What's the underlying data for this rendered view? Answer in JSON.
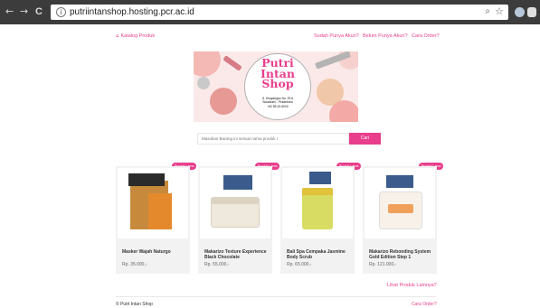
{
  "browser": {
    "back_icon": "←",
    "forward_icon": "→",
    "reload_icon": "C",
    "info_icon": "i",
    "url": "putriintanshop.hosting.pcr.ac.id",
    "zoom_icon": "⌕",
    "star_icon": "☆"
  },
  "nav": {
    "home_icon": "⌂",
    "catalog": "Katalog Produk",
    "has_account": "Sudah Punya Akun?",
    "no_account": "Belum Punya Akun?",
    "track_order": "Cara Order?"
  },
  "banner": {
    "brand_line1": "Putri",
    "brand_line2": "Intan",
    "brand_line3": "Shop",
    "address_line1": "Jl. Khayangan No. 29 A",
    "address_line2": "Sukabumi - Pekanbaru",
    "address_line3": "+62 85-22-6000"
  },
  "search": {
    "placeholder": "Masukan Barang ini sesuai nama produk !",
    "button": "Cari"
  },
  "badge_label": "Produk Lama",
  "products": [
    {
      "name": "Masker Wajah Naturgo",
      "price": "Rp. 35.000,-"
    },
    {
      "name": "Makarizo Texture Experience Black Chocolate",
      "price": "Rp. 55.000,-"
    },
    {
      "name": "Bali Spa Cempaka Jasmine Body Scrub",
      "price": "Rp. 65.000,-"
    },
    {
      "name": "Makarizo Rebonding System Gold Edition Step 1",
      "price": "Rp. 121.000,-"
    }
  ],
  "more_link": "Lihat Produk Lainnya?",
  "footer": {
    "copyright": "© Putri Intan Shop",
    "right_link": "Cara Order?"
  },
  "colors": {
    "accent": "#e83e8c",
    "chrome": "#3c3c3c",
    "card_bg": "#f2f2f2"
  }
}
